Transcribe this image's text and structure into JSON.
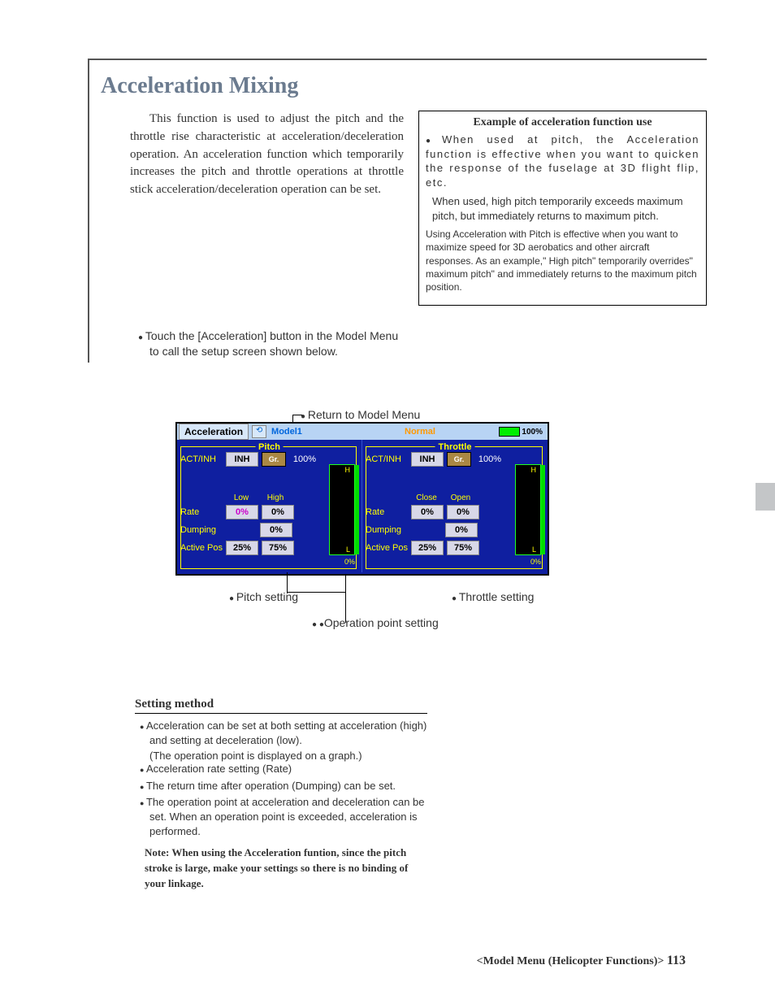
{
  "title": "Acceleration Mixing",
  "intro": "This function is used to adjust the pitch and the throttle rise characteristic at acceleration/deceleration operation. An acceleration function which temporarily increases the pitch and throttle operations at throttle stick acceleration/deceleration operation can be set.",
  "example": {
    "title": "Example of acceleration function use",
    "p1": "When used at pitch, the Acceleration function is effective when you want to quicken the response of the fuselage at 3D flight flip, etc.",
    "p2": "When used, high pitch temporarily exceeds maximum pitch, but immediately returns to maximum pitch.",
    "p3": "Using Acceleration with Pitch is effective when you want to maximize speed for 3D aerobatics and other aircraft responses. As an example,\" High pitch\" temporarily overrides\" maximum pitch\" and immediately returns to the maximum pitch position."
  },
  "instruction": "Touch the [Acceleration] button in the Model Menu to call the setup screen shown below.",
  "return_label": "Return to Model Menu",
  "screen": {
    "tab": "Acceleration",
    "model": "Model1",
    "mode": "Normal",
    "battery": "100%",
    "pitch": {
      "title": "Pitch",
      "act": "ACT/INH",
      "inh": "INH",
      "gr": "Gr.",
      "pct100": "100%",
      "low": "Low",
      "high": "High",
      "h": "H",
      "l": "L",
      "rate": "Rate",
      "rate_low": "0%",
      "rate_high": "0%",
      "dumping": "Dumping",
      "dump_val": "0%",
      "active": "Active Pos",
      "ap_low": "25%",
      "ap_high": "75%",
      "zero": "0%"
    },
    "throttle": {
      "title": "Throttle",
      "act": "ACT/INH",
      "inh": "INH",
      "gr": "Gr.",
      "pct100": "100%",
      "close": "Close",
      "open": "Open",
      "h": "H",
      "l": "L",
      "rate": "Rate",
      "rate_low": "0%",
      "rate_high": "0%",
      "dumping": "Dumping",
      "dump_val": "0%",
      "active": "Active Pos",
      "ap_low": "25%",
      "ap_high": "75%",
      "zero": "0%"
    }
  },
  "under": {
    "pitch": "Pitch setting",
    "throttle": "Throttle setting",
    "op": "Operation point setting"
  },
  "setting": {
    "title": "Setting method",
    "items": [
      "Acceleration can be set at both setting at acceleration (high) and setting at deceleration (low).",
      "(The operation point is displayed on a graph.)",
      "Acceleration rate setting (Rate)",
      "The return time after operation (Dumping) can be set.",
      "The operation point at acceleration and deceleration can be set. When an operation point is exceeded, acceleration is performed."
    ],
    "note": "Note: When using the Acceleration funtion, since the pitch stroke is large, make your settings so there is no binding of your linkage."
  },
  "footer": {
    "section": "<Model Menu (Helicopter Functions)>",
    "page": "113"
  }
}
